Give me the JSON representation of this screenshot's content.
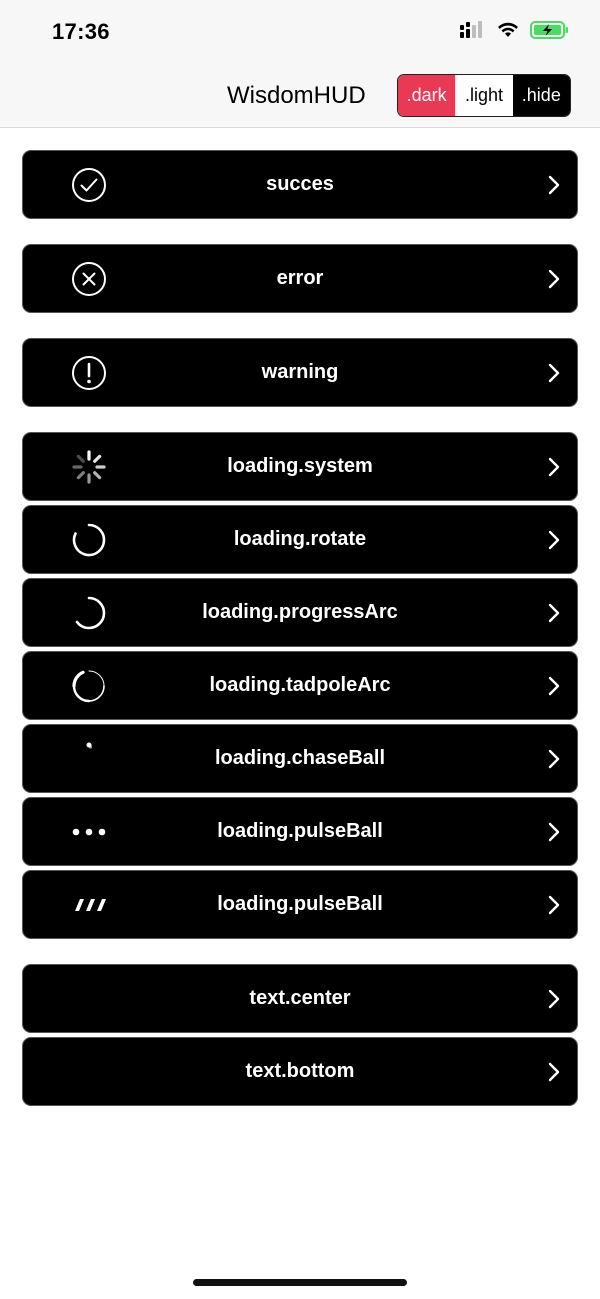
{
  "status_bar": {
    "time": "17:36",
    "icons": [
      "cellular-signal-icon",
      "wifi-icon",
      "battery-charging-icon"
    ]
  },
  "nav": {
    "title": "WisdomHUD",
    "segments": [
      ".dark",
      ".light",
      ".hide"
    ]
  },
  "rows": [
    {
      "label": "succes",
      "icon": "checkmark-circle-icon"
    },
    {
      "label": "error",
      "icon": "x-circle-icon"
    },
    {
      "label": "warning",
      "icon": "exclamation-circle-icon"
    },
    {
      "label": "loading.system",
      "icon": "system-spinner-icon"
    },
    {
      "label": "loading.rotate",
      "icon": "rotate-arc-icon"
    },
    {
      "label": "loading.progressArc",
      "icon": "progress-arc-icon"
    },
    {
      "label": "loading.tadpoleArc",
      "icon": "tadpole-arc-icon"
    },
    {
      "label": "loading.chaseBall",
      "icon": "chase-ball-icon"
    },
    {
      "label": "loading.pulseBall",
      "icon": "pulse-ball-dots-icon"
    },
    {
      "label": "loading.pulseBall",
      "icon": "pulse-ball-bars-icon"
    },
    {
      "label": "text.center",
      "icon": ""
    },
    {
      "label": "text.bottom",
      "icon": ""
    }
  ],
  "colors": {
    "accent_dark_segment": "#e93a55",
    "row_background": "#000000",
    "battery_fill": "#4cd964"
  }
}
